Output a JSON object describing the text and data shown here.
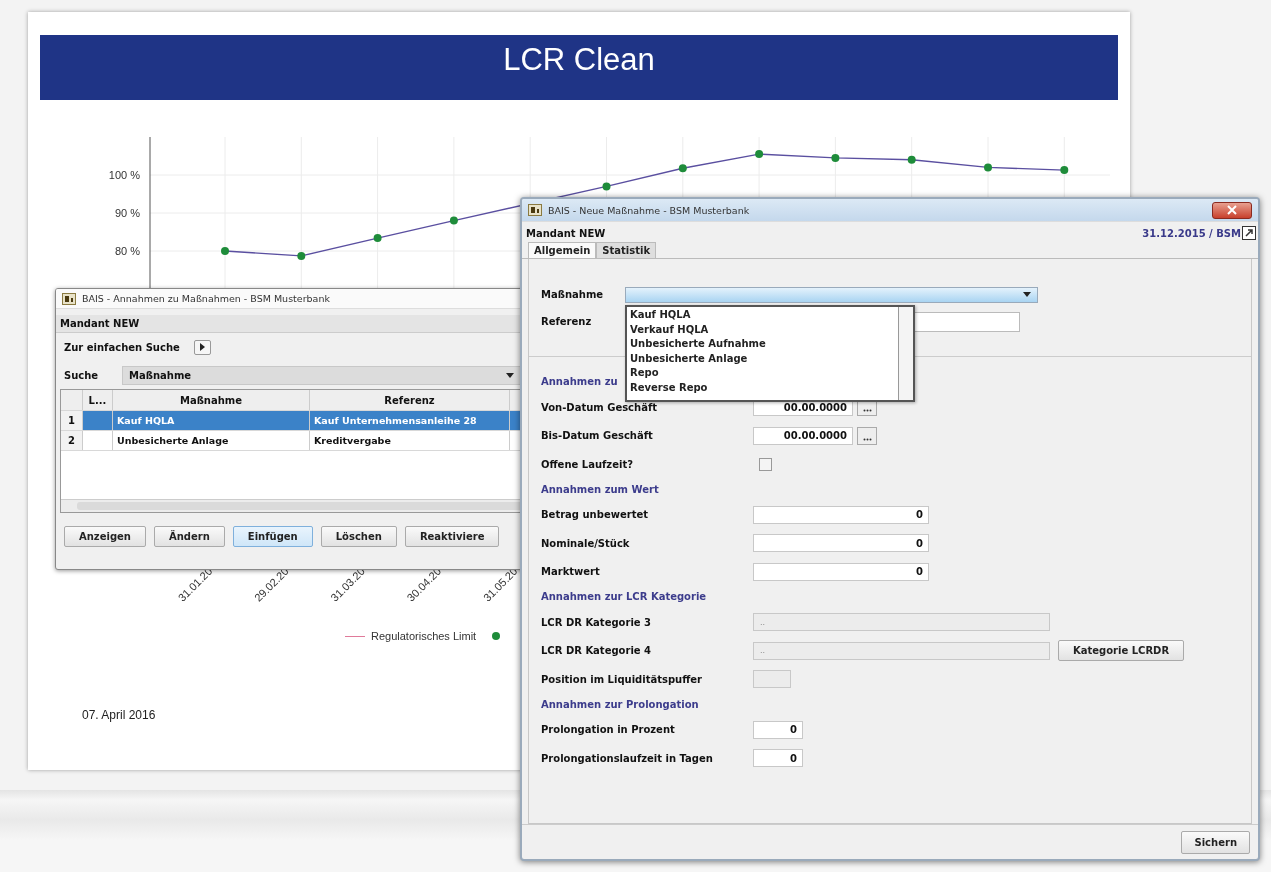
{
  "report": {
    "title": "LCR Clean",
    "chart": {
      "chart_data": {
        "type": "line",
        "categories": [
          "31.01.20",
          "29.02.20",
          "31.03.20",
          "30.04.20",
          "31.05.20",
          null,
          null,
          null,
          null,
          null,
          null,
          null
        ],
        "ylim": [
          0,
          110
        ],
        "grid": true,
        "yticks": [
          {
            "value": 80,
            "label": "80 %"
          },
          {
            "value": 90,
            "label": "90 %"
          },
          {
            "value": 100,
            "label": "100 %"
          }
        ],
        "series": [
          {
            "color": "#1e8c3a",
            "marker": true,
            "values": [
              80,
              78.7,
              83.4,
              88,
              null,
              97,
              101.8,
              105.5,
              104.5,
              104,
              102,
              101.3
            ]
          }
        ]
      }
    },
    "legend": [
      {
        "kind": "line",
        "label": "Regulatorisches Limit",
        "color": "#e07a9a"
      },
      {
        "kind": "marker",
        "color": "#1e8c3a"
      }
    ],
    "date": "07. April 2016"
  },
  "measures_window": {
    "title": "BAIS - Annahmen zu Maßnahmen - BSM Musterbank",
    "client": "Mandant NEW",
    "simple_search": "Zur einfachen Suche",
    "search_label": "Suche",
    "search_value": "Maßnahme",
    "table": {
      "columns": [
        "L...",
        "Maßnahme",
        "Referenz"
      ],
      "rows": [
        {
          "number": "1",
          "cells": [
            "Kauf HQLA",
            "Kauf Unternehmensanleihe 28"
          ],
          "selected": true
        },
        {
          "number": "2",
          "cells": [
            "Unbesicherte Anlage",
            "Kreditvergabe"
          ],
          "selected": false
        }
      ]
    },
    "buttons": [
      {
        "label": "Anzeigen",
        "default": false
      },
      {
        "label": "Ändern",
        "default": false
      },
      {
        "label": "Einfügen",
        "default": true
      },
      {
        "label": "Löschen",
        "default": false
      },
      {
        "label": "Reaktiviere",
        "default": false
      }
    ]
  },
  "new_measure_window": {
    "title": "BAIS - Neue Maßnahme - BSM Musterbank",
    "client": "Mandant NEW",
    "context": "31.12.2015 / BSM",
    "tabs": [
      {
        "label": "Allgemein",
        "selected": true
      },
      {
        "label": "Statistik",
        "selected": false
      }
    ],
    "measure": {
      "label": "Maßnahme",
      "expanded": true,
      "options": [
        "Kauf HQLA",
        "Verkauf HQLA",
        "Unbesicherte Aufnahme",
        "Unbesicherte Anlage",
        "Repo",
        "Reverse Repo"
      ]
    },
    "reference": {
      "label": "Referenz"
    },
    "sections": [
      {
        "heading": "Annahmen zu",
        "fields": [
          {
            "kind": "date",
            "label": "Von-Datum Geschäft",
            "value": "00.00.0000"
          },
          {
            "kind": "date",
            "label": "Bis-Datum Geschäft",
            "value": "00.00.0000"
          },
          {
            "kind": "checkbox",
            "label": "Offene Laufzeit?",
            "checked": false
          }
        ]
      },
      {
        "heading": "Annahmen zum Wert",
        "fields": [
          {
            "kind": "number",
            "label": "Betrag unbewertet",
            "value": "0"
          },
          {
            "kind": "number",
            "label": "Nominale/Stück",
            "value": "0"
          },
          {
            "kind": "number",
            "label": "Marktwert",
            "value": "0"
          }
        ]
      },
      {
        "heading": "Annahmen zur LCR Kategorie",
        "fields": [
          {
            "kind": "readonly",
            "label": "LCR DR Kategorie 3",
            "value": ".."
          },
          {
            "kind": "readonly",
            "label": "LCR DR Kategorie 4",
            "value": "..",
            "button": "Kategorie LCRDR"
          },
          {
            "kind": "small",
            "label": "Position im Liquiditätspuffer"
          }
        ]
      },
      {
        "heading": "Annahmen zur Prolongation",
        "fields": [
          {
            "kind": "short",
            "label": "Prolongation in Prozent",
            "value": "0"
          },
          {
            "kind": "short",
            "label": "Prolongationslaufzeit in Tagen",
            "value": "0"
          }
        ]
      }
    ],
    "save_button": "Sichern"
  }
}
